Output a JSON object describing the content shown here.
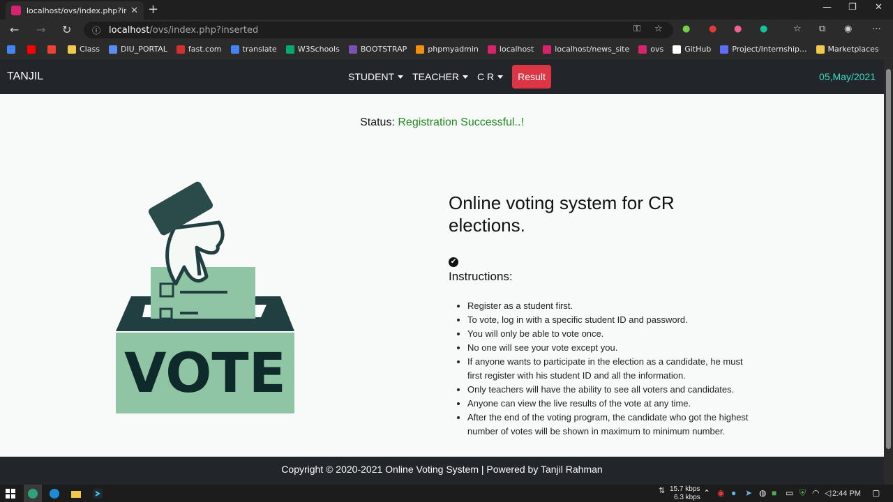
{
  "browser": {
    "tab_title": "localhost/ovs/index.php?inserted",
    "url_host": "localhost",
    "url_path": "/ovs/index.php?inserted",
    "bookmarks": [
      {
        "label": "",
        "color": "#4285f4"
      },
      {
        "label": "",
        "color": "#ff0000"
      },
      {
        "label": "",
        "color": "#ea4335"
      },
      {
        "label": "Class",
        "color": "#f2c94c"
      },
      {
        "label": "DIU_PORTAL",
        "color": "#5b8def"
      },
      {
        "label": "fast.com",
        "color": "#d0312d"
      },
      {
        "label": "translate",
        "color": "#4285f4"
      },
      {
        "label": "W3Schools",
        "color": "#04aa6d"
      },
      {
        "label": "BOOTSTRAP",
        "color": "#7952b3"
      },
      {
        "label": "phpmyadmin",
        "color": "#f29111"
      },
      {
        "label": "localhost",
        "color": "#d6246e"
      },
      {
        "label": "localhost/news_site",
        "color": "#d6246e"
      },
      {
        "label": "ovs",
        "color": "#d6246e"
      },
      {
        "label": "GitHub",
        "color": "#ffffff"
      },
      {
        "label": "Project/Internship...",
        "color": "#5b6ef5"
      },
      {
        "label": "Marketplaces",
        "color": "#f2c94c"
      }
    ]
  },
  "navbar": {
    "brand": "TANJIL",
    "menu": [
      "STUDENT",
      "TEACHER",
      "C R"
    ],
    "result_label": "Result",
    "date": "05,May/2021"
  },
  "status": {
    "label": "Status:",
    "message": "Registration Successful..!"
  },
  "vote_art": {
    "word": "VOTE"
  },
  "main": {
    "headline": "Online voting system for CR elections.",
    "check_icon": "✔",
    "instructions_title": "Instructions:",
    "instructions": [
      "Register as a student first.",
      "To vote, log in with a specific student ID and password.",
      "You will only be able to vote once.",
      "No one will see your vote except you.",
      "If anyone wants to participate in the election as a candidate, he must first register with his student ID and all the information.",
      "Only teachers will have the ability to see all voters and candidates.",
      "Anyone can view the live results of the vote at any time.",
      "After the end of the voting program, the candidate who got the highest number of votes will be shown in maximum to minimum number."
    ]
  },
  "footer": {
    "text": "Copyright © 2020-2021 Online Voting System | Powered by Tanjil Rahman"
  },
  "taskbar": {
    "net_down": "15.7 kbps",
    "net_up": "6.3 kbps",
    "time": "2:44 PM"
  }
}
